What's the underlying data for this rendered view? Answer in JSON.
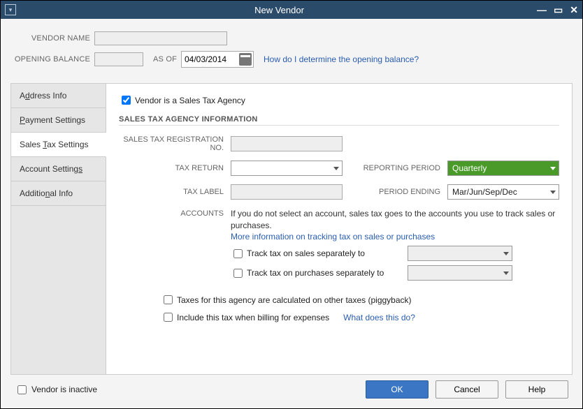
{
  "window": {
    "title": "New Vendor"
  },
  "top": {
    "vendor_name_label": "VENDOR NAME",
    "vendor_name_value": "",
    "opening_balance_label": "OPENING BALANCE",
    "opening_balance_value": "",
    "as_of_label": "AS OF",
    "as_of_date": "04/03/2014",
    "opening_balance_help": "How do I determine the opening balance?"
  },
  "tabs": [
    {
      "label_pre": "A",
      "label_u": "d",
      "label_post": "dress Info"
    },
    {
      "label_pre": "",
      "label_u": "P",
      "label_post": "ayment Settings"
    },
    {
      "label_pre": "Sales ",
      "label_u": "T",
      "label_post": "ax Settings"
    },
    {
      "label_pre": "Account Setting",
      "label_u": "s",
      "label_post": ""
    },
    {
      "label_pre": "Additio",
      "label_u": "n",
      "label_post": "al Info"
    }
  ],
  "panel": {
    "is_sales_tax_agency_label": "Vendor is a Sales Tax Agency",
    "section_title": "SALES TAX AGENCY INFORMATION",
    "reg_no_label": "SALES TAX REGISTRATION NO.",
    "reg_no_value": "",
    "tax_return_label": "TAX RETURN",
    "tax_return_value": "",
    "reporting_period_label": "REPORTING PERIOD",
    "reporting_period_value": "Quarterly",
    "tax_label_label": "TAX LABEL",
    "tax_label_value": "",
    "period_ending_label": "PERIOD ENDING",
    "period_ending_value": "Mar/Jun/Sep/Dec",
    "accounts_label": "ACCOUNTS",
    "accounts_text": "If you do not select an account, sales tax goes to the accounts you use to track sales or purchases.",
    "more_info_link": "More information on tracking tax on sales or purchases",
    "track_sales_label": "Track tax on sales separately to",
    "track_purchases_label": "Track tax on purchases separately to",
    "piggyback_label": "Taxes for this agency are calculated on other taxes (piggyback)",
    "include_billing_label": "Include this tax when billing for expenses",
    "what_does_link": "What does this do?"
  },
  "footer": {
    "inactive_label": "Vendor is inactive",
    "ok": "OK",
    "cancel": "Cancel",
    "help": "Help"
  }
}
